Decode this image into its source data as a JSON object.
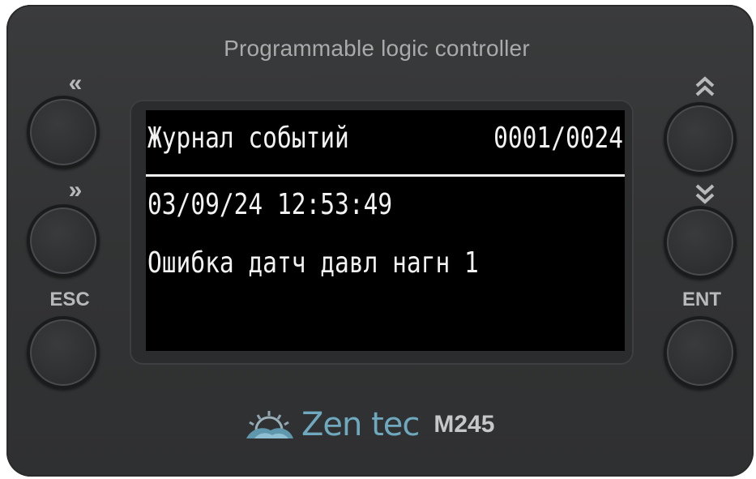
{
  "device": {
    "title": "Programmable logic controller",
    "brand": "Zen tec",
    "model": "M245"
  },
  "buttons": {
    "left_top_glyph": "«",
    "left_mid_glyph": "»",
    "left_bottom_label": "ESC",
    "right_top_glyph": "˄",
    "right_mid_glyph": "˅",
    "right_bottom_label": "ENT"
  },
  "screen": {
    "header_title": "Журнал событий",
    "counter": "0001/0024",
    "timestamp": "03/09/24 12:53:49",
    "message": "Ошибка датч давл нагн 1"
  },
  "colors": {
    "body": "#333435",
    "screen_bg": "#000000",
    "screen_text": "#f2f2f2",
    "brand": "#6fa9bf"
  }
}
